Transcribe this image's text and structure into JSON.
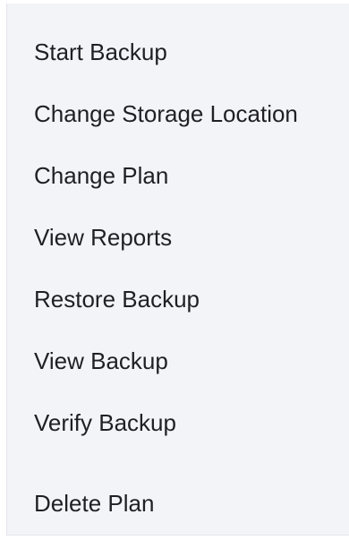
{
  "context_menu": {
    "items": [
      {
        "label": "Start Backup"
      },
      {
        "label": "Change Storage Location"
      },
      {
        "label": "Change Plan"
      },
      {
        "label": "View Reports"
      },
      {
        "label": "Restore Backup"
      },
      {
        "label": "View Backup"
      },
      {
        "label": "Verify Backup"
      },
      {
        "label": "Delete Plan"
      }
    ]
  },
  "colors": {
    "menu_background": "#f3f4f8",
    "text": "#1f1f24"
  }
}
